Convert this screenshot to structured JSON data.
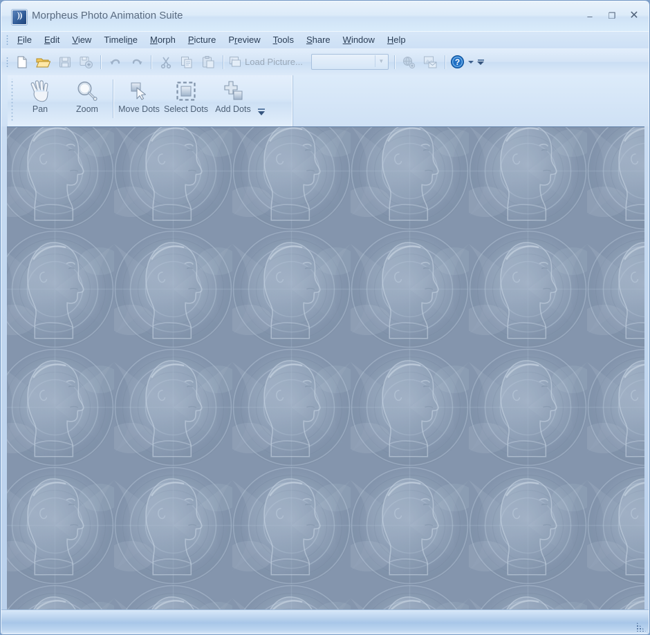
{
  "window": {
    "title": "Morpheus Photo Animation Suite",
    "app_icon": "app-icon",
    "controls": {
      "minimize": "–",
      "maximize": "❐",
      "close": "✕"
    }
  },
  "menubar": {
    "items": [
      {
        "label": "File",
        "accel": "F"
      },
      {
        "label": "Edit",
        "accel": "E"
      },
      {
        "label": "View",
        "accel": "V"
      },
      {
        "label": "Timeline",
        "accel": "n"
      },
      {
        "label": "Morph",
        "accel": "M"
      },
      {
        "label": "Picture",
        "accel": "P"
      },
      {
        "label": "Preview",
        "accel": "r"
      },
      {
        "label": "Tools",
        "accel": "T"
      },
      {
        "label": "Share",
        "accel": "S"
      },
      {
        "label": "Window",
        "accel": "W"
      },
      {
        "label": "Help",
        "accel": "H"
      }
    ]
  },
  "toolbar": {
    "buttons": [
      {
        "name": "new",
        "icon": "new-document-icon",
        "enabled": true
      },
      {
        "name": "open",
        "icon": "open-folder-icon",
        "enabled": true
      },
      {
        "name": "save",
        "icon": "save-disk-icon",
        "enabled": false
      },
      {
        "name": "saveas",
        "icon": "save-as-icon",
        "enabled": false
      },
      {
        "name": "undo",
        "icon": "undo-arrow-icon",
        "enabled": false
      },
      {
        "name": "redo",
        "icon": "redo-arrow-icon",
        "enabled": false
      },
      {
        "name": "cut",
        "icon": "scissors-icon",
        "enabled": false
      },
      {
        "name": "copy",
        "icon": "copy-icon",
        "enabled": false
      },
      {
        "name": "paste",
        "icon": "paste-icon",
        "enabled": false
      }
    ],
    "load_picture_label": "Load Picture...",
    "load_picture_icon": "picture-icon",
    "picture_combo_value": "",
    "picture_combo_placeholder": "",
    "share_web_icon": "globe-share-icon",
    "share_email_icon": "email-picture-icon",
    "help_icon": "help-question-icon",
    "help_dropdown_icon": "chevron-down-icon",
    "overflow_icon": "toolbar-overflow-icon"
  },
  "tools": {
    "items": [
      {
        "label": "Pan",
        "icon": "hand-pan-icon",
        "selected": false
      },
      {
        "label": "Zoom",
        "icon": "magnifier-icon",
        "selected": false
      },
      {
        "label": "Move Dots",
        "icon": "move-dots-icon",
        "selected": false
      },
      {
        "label": "Select Dots",
        "icon": "select-dots-icon",
        "selected": false
      },
      {
        "label": "Add Dots",
        "icon": "add-dots-icon",
        "selected": false
      }
    ],
    "overflow_icon": "toolbar-overflow-icon"
  },
  "canvas": {
    "name": "document-canvas",
    "background_pattern": "tiled-face-profile-wallpaper",
    "colors": {
      "base": "#8596ae",
      "highlight": "#c6d4e4",
      "shadow": "#6f8099"
    }
  },
  "statusbar": {
    "text": "",
    "resize_grip_icon": "resize-grip-icon"
  },
  "theme": {
    "accent": "#3b6ea5",
    "frame": "#b9d0ec",
    "title_text": "#5a6b80",
    "menu_text": "#2a3d55"
  }
}
